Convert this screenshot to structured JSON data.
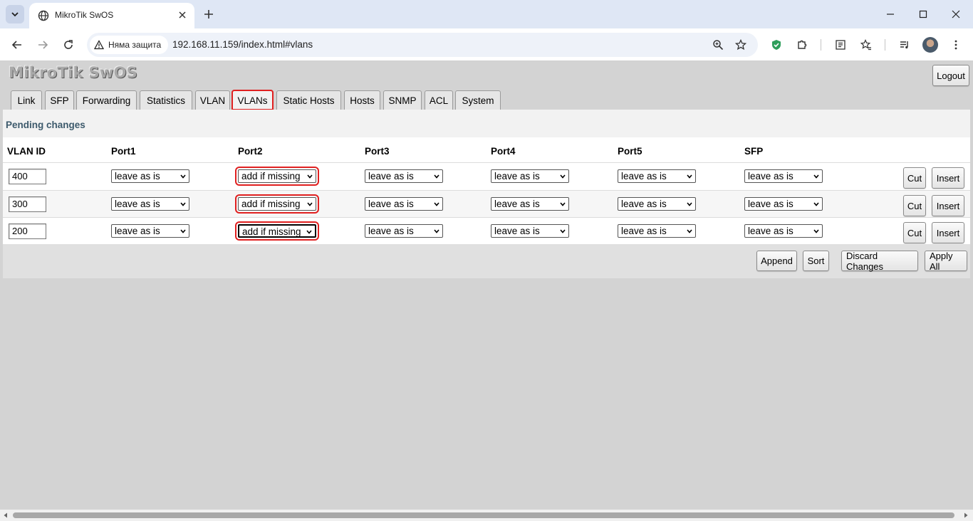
{
  "browser": {
    "tab_title": "MikroTik SwOS",
    "security_label": "Няма защита",
    "url": "192.168.11.159/index.html#vlans"
  },
  "app": {
    "logo": "MikroTik SwOS",
    "logout_label": "Logout",
    "tabs": [
      "Link",
      "SFP",
      "Forwarding",
      "Statistics",
      "VLAN",
      "VLANs",
      "Static Hosts",
      "Hosts",
      "SNMP",
      "ACL",
      "System"
    ],
    "active_tab": "VLANs"
  },
  "vlans": {
    "pending_label": "Pending changes",
    "columns": [
      "VLAN ID",
      "Port1",
      "Port2",
      "Port3",
      "Port4",
      "Port5",
      "SFP"
    ],
    "rows": [
      {
        "vlan_id": "400",
        "ports": [
          "leave as is",
          "add if missing",
          "leave as is",
          "leave as is",
          "leave as is",
          "leave as is"
        ]
      },
      {
        "vlan_id": "300",
        "ports": [
          "leave as is",
          "add if missing",
          "leave as is",
          "leave as is",
          "leave as is",
          "leave as is"
        ]
      },
      {
        "vlan_id": "200",
        "ports": [
          "leave as is",
          "add if missing",
          "leave as is",
          "leave as is",
          "leave as is",
          "leave as is"
        ]
      }
    ],
    "row_buttons": {
      "cut": "Cut",
      "insert": "Insert"
    },
    "footer_buttons": {
      "append": "Append",
      "sort": "Sort",
      "discard": "Discard Changes",
      "apply": "Apply All"
    }
  },
  "colors": {
    "highlight": "#e02020",
    "pending_text": "#3d5a6c",
    "page_bg": "#d3d3d3"
  }
}
